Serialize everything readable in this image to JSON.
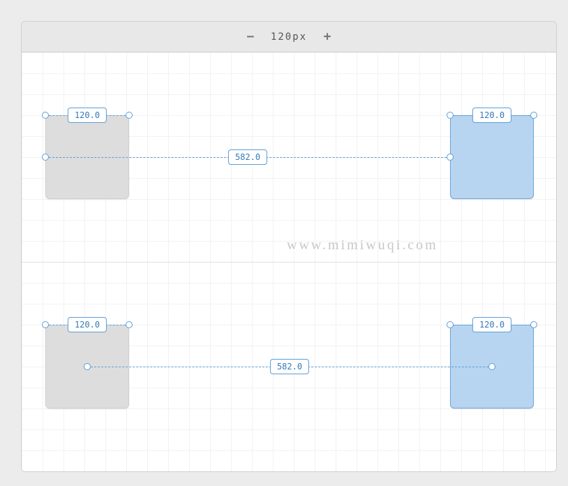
{
  "toolbar": {
    "minus_glyph": "−",
    "size_label": "120px",
    "plus_glyph": "+"
  },
  "section1": {
    "box_left_width_label": "120.0",
    "box_right_width_label": "120.0",
    "gap_label": "582.0"
  },
  "section2": {
    "box_left_width_label": "120.0",
    "box_right_width_label": "120.0",
    "gap_label": "582.0"
  },
  "watermark": "www.mimiwuqi.com"
}
